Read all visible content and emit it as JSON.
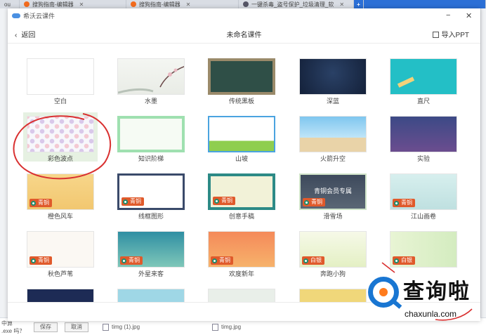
{
  "browser": {
    "tabs": [
      {
        "label": "ou"
      },
      {
        "label": "搜狗指南-编辑器"
      },
      {
        "label": "搜狗指南-编辑器"
      },
      {
        "label": "一键杀毒_盗号保护_垃圾清理_软"
      }
    ],
    "new_tab": "+"
  },
  "left_strip": {
    "text": "ou"
  },
  "bottom_bar": {
    "line1": "中算",
    "line2": ".exe 吗？",
    "btn1": "保存",
    "btn2": "取消",
    "file1": "timg (1).jpg",
    "file2": "timg.jpg"
  },
  "dialog": {
    "app_title": "希沃云课件",
    "minimize": "−",
    "close": "✕",
    "back_label": "返回",
    "page_title": "未命名课件",
    "import_label": "导入PPT"
  },
  "templates": [
    {
      "name": "空白"
    },
    {
      "name": "水墨"
    },
    {
      "name": "传统黑板"
    },
    {
      "name": "深蓝"
    },
    {
      "name": "直尺"
    },
    {
      "name": "彩色波点"
    },
    {
      "name": "知识阶梯"
    },
    {
      "name": "山坡"
    },
    {
      "name": "火箭升空"
    },
    {
      "name": "实验"
    },
    {
      "name": "橙色风车",
      "badge": "青铜"
    },
    {
      "name": "线框图形",
      "badge": "青铜"
    },
    {
      "name": "创意手稿",
      "badge": "青铜"
    },
    {
      "name": "滑雪场",
      "badge": "青铜",
      "overlay": "青铜会员专属"
    },
    {
      "name": "江山画卷",
      "badge": "青铜"
    },
    {
      "name": "秋色芦苇",
      "badge": "青铜"
    },
    {
      "name": "外星来客",
      "badge": "青铜"
    },
    {
      "name": "欢度新年",
      "badge": "青铜"
    },
    {
      "name": "奔跑小狗",
      "badge": "白银"
    },
    {
      "name": "",
      "badge": "白银"
    }
  ],
  "watermark": {
    "big": "查询啦",
    "small": "chaxunla.com"
  },
  "colors": {
    "badge": "#e05a2b",
    "accent": "#2b6fd6",
    "annotation": "#d93030"
  }
}
